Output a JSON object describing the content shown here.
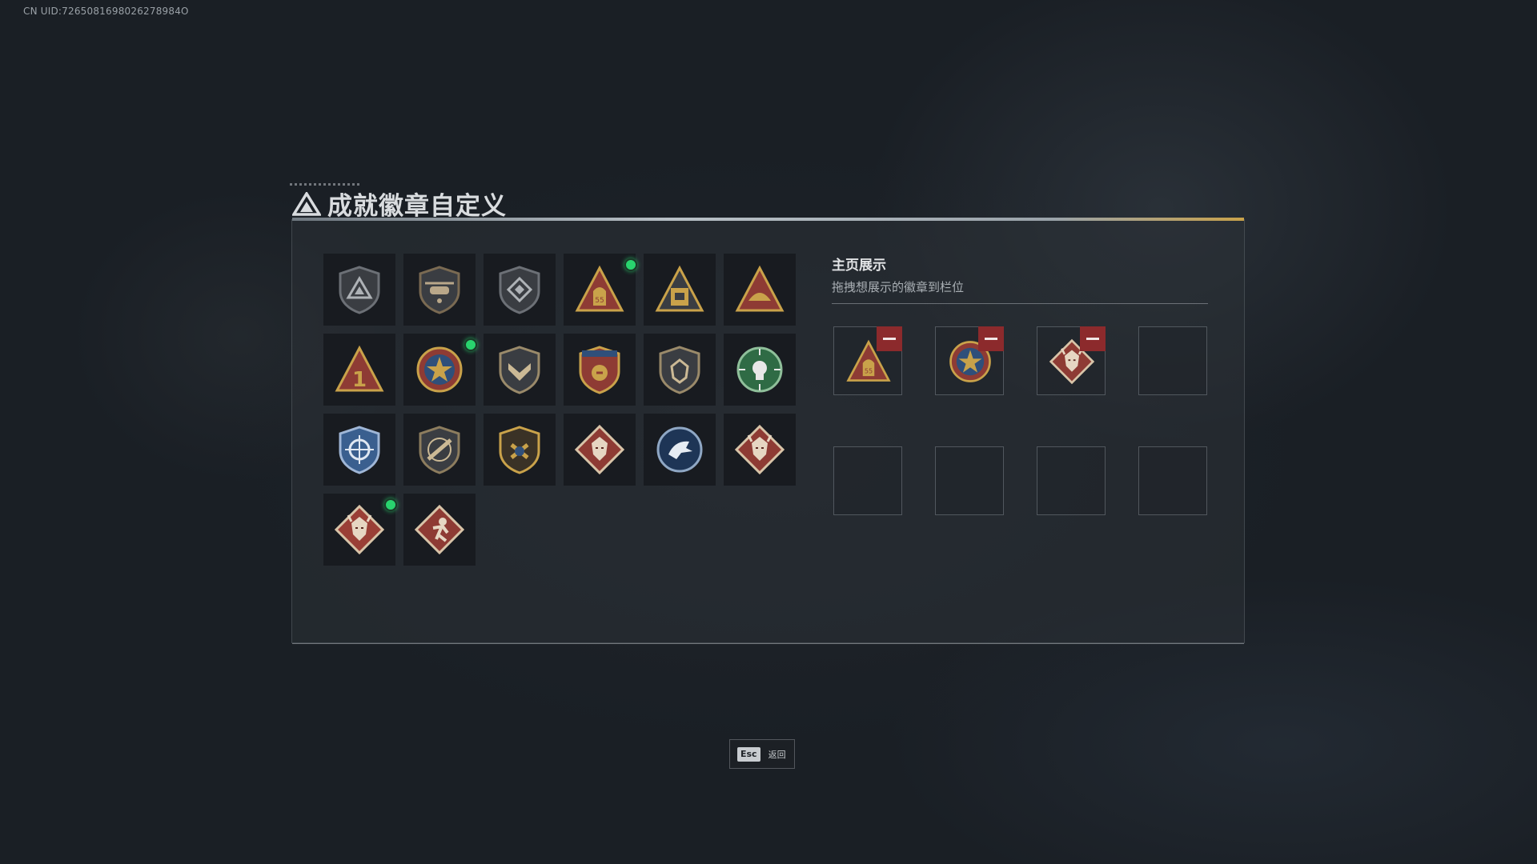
{
  "header": {
    "uid": "CN UID:7265081698026278984O"
  },
  "page": {
    "title": "成就徽章自定义",
    "logo_icon": "delta-logo-icon"
  },
  "badges": [
    {
      "icon": "badge-dark-triangle-shield",
      "new": false
    },
    {
      "icon": "badge-helicopter-shield",
      "new": false
    },
    {
      "icon": "badge-diamond-shield",
      "new": false
    },
    {
      "icon": "badge-gold-bag-triangle",
      "new": true
    },
    {
      "icon": "badge-gold-crate-triangle",
      "new": false
    },
    {
      "icon": "badge-gold-fist-triangle",
      "new": false
    },
    {
      "icon": "badge-red-one-triangle",
      "new": false
    },
    {
      "icon": "badge-star-medal",
      "new": true
    },
    {
      "icon": "badge-wing-shield",
      "new": false
    },
    {
      "icon": "badge-eagle-crest",
      "new": false
    },
    {
      "icon": "badge-lion-shield",
      "new": false
    },
    {
      "icon": "badge-green-skull-target",
      "new": false
    },
    {
      "icon": "badge-blue-crosshair-shield",
      "new": false
    },
    {
      "icon": "badge-rifle-shield",
      "new": false
    },
    {
      "icon": "badge-gold-anchor-crest",
      "new": false
    },
    {
      "icon": "badge-wolf-diamond",
      "new": false
    },
    {
      "icon": "badge-blue-eagle-circle",
      "new": false
    },
    {
      "icon": "badge-dragon-diamond",
      "new": false
    },
    {
      "icon": "badge-dragon-diamond-red",
      "new": true
    },
    {
      "icon": "badge-runner-diamond",
      "new": false
    }
  ],
  "showcase": {
    "title": "主页展示",
    "subtitle": "拖拽想展示的徽章到栏位",
    "slots": [
      {
        "icon": "badge-gold-bag-triangle",
        "filled": true
      },
      {
        "icon": "badge-star-medal",
        "filled": true
      },
      {
        "icon": "badge-dragon-diamond",
        "filled": true
      },
      {
        "icon": "",
        "filled": false
      },
      {
        "icon": "",
        "filled": false
      },
      {
        "icon": "",
        "filled": false
      },
      {
        "icon": "",
        "filled": false
      },
      {
        "icon": "",
        "filled": false
      }
    ],
    "remove_icon": "minus-icon"
  },
  "footer": {
    "esc_key": "Esc",
    "back_label": "返回"
  },
  "colors": {
    "new_dot": "#29d46e",
    "remove": "#8c2a2c",
    "gold": "#c9a24a"
  }
}
